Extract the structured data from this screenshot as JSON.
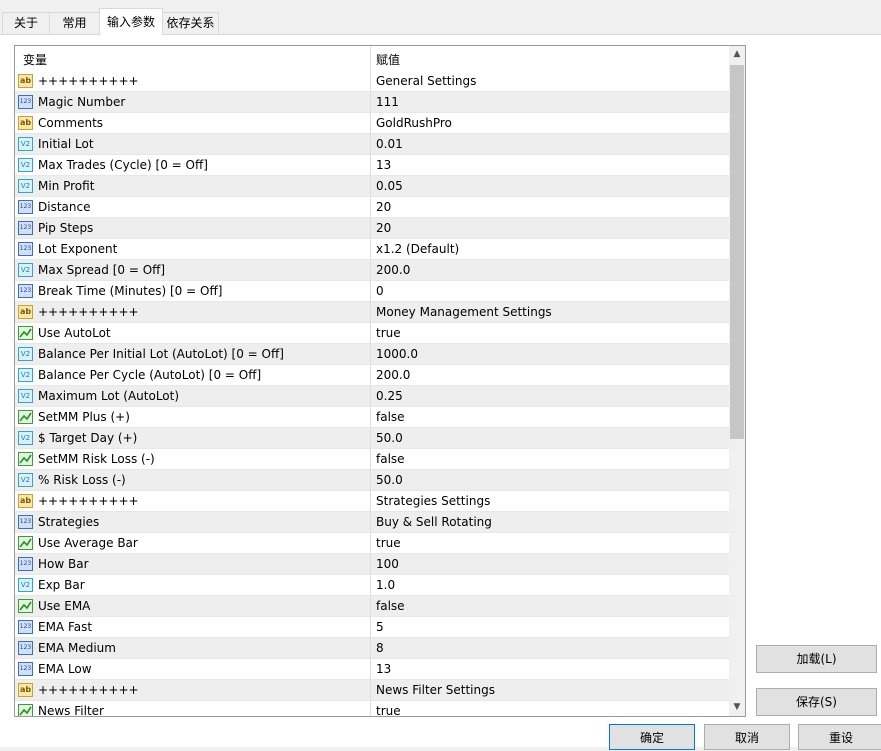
{
  "tabs": [
    "关于",
    "常用",
    "输入参数",
    "依存关系"
  ],
  "grid": {
    "col_variable": "变量",
    "col_value": "赋值",
    "rows": [
      {
        "icon": "ab",
        "name": "++++++++++",
        "value": "General Settings"
      },
      {
        "icon": "123",
        "name": "Magic Number",
        "value": "111"
      },
      {
        "icon": "ab",
        "name": "Comments",
        "value": "GoldRushPro"
      },
      {
        "icon": "v2",
        "name": "Initial Lot",
        "value": "0.01"
      },
      {
        "icon": "v2",
        "name": "Max Trades (Cycle) [0 = Off]",
        "value": "13"
      },
      {
        "icon": "v2",
        "name": "Min Profit",
        "value": "0.05"
      },
      {
        "icon": "123",
        "name": "Distance",
        "value": "20"
      },
      {
        "icon": "123",
        "name": "Pip Steps",
        "value": "20"
      },
      {
        "icon": "123",
        "name": "Lot Exponent",
        "value": "x1.2 (Default)"
      },
      {
        "icon": "v2",
        "name": "Max Spread [0 = Off]",
        "value": "200.0"
      },
      {
        "icon": "123",
        "name": "Break Time (Minutes) [0 = Off]",
        "value": "0"
      },
      {
        "icon": "ab",
        "name": "++++++++++",
        "value": "Money Management Settings"
      },
      {
        "icon": "bool",
        "name": "Use AutoLot",
        "value": "true"
      },
      {
        "icon": "v2",
        "name": "Balance Per Initial Lot (AutoLot) [0 = Off]",
        "value": "1000.0"
      },
      {
        "icon": "v2",
        "name": "Balance Per Cycle (AutoLot) [0 = Off]",
        "value": "200.0"
      },
      {
        "icon": "v2",
        "name": "Maximum Lot (AutoLot)",
        "value": "0.25"
      },
      {
        "icon": "bool",
        "name": "SetMM Plus (+)",
        "value": "false"
      },
      {
        "icon": "v2",
        "name": "$ Target Day (+)",
        "value": "50.0"
      },
      {
        "icon": "bool",
        "name": "SetMM Risk Loss (-)",
        "value": "false"
      },
      {
        "icon": "v2",
        "name": "% Risk Loss (-)",
        "value": "50.0"
      },
      {
        "icon": "ab",
        "name": "++++++++++",
        "value": "Strategies Settings"
      },
      {
        "icon": "123",
        "name": "Strategies",
        "value": "Buy & Sell Rotating"
      },
      {
        "icon": "bool",
        "name": "Use Average Bar",
        "value": "true"
      },
      {
        "icon": "123",
        "name": "How Bar",
        "value": "100"
      },
      {
        "icon": "v2",
        "name": "Exp Bar",
        "value": "1.0"
      },
      {
        "icon": "bool",
        "name": "Use EMA",
        "value": "false"
      },
      {
        "icon": "123",
        "name": "EMA Fast",
        "value": "5"
      },
      {
        "icon": "123",
        "name": "EMA Medium",
        "value": "8"
      },
      {
        "icon": "123",
        "name": "EMA Low",
        "value": "13"
      },
      {
        "icon": "ab",
        "name": "++++++++++",
        "value": "News Filter Settings"
      },
      {
        "icon": "bool",
        "name": "News Filter",
        "value": "true"
      }
    ]
  },
  "icon_texts": {
    "ab": "ab",
    "123": "123",
    "v2": "V2"
  },
  "buttons": {
    "load": "加载(L)",
    "save": "保存(S)",
    "ok": "确定",
    "cancel": "取消",
    "reset": "重设"
  },
  "colors": {
    "row_alt": "#eeeeee",
    "accent": "#0078d7"
  }
}
